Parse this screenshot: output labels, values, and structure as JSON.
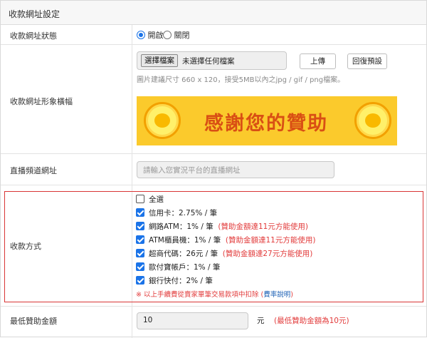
{
  "page": {
    "title": "收款網址設定"
  },
  "status": {
    "label": "收款網址狀態",
    "options": [
      {
        "label": "開啟",
        "selected": true
      },
      {
        "label": "關閉",
        "selected": false
      }
    ]
  },
  "image": {
    "label": "收款網址形象橫幅",
    "file_button": "選擇檔案",
    "file_status": "未選擇任何檔案",
    "upload_button": "上傳",
    "reset_button": "回復預設",
    "hint": "圖片建議尺寸 660 x 120，接受5MB以內之jpg / gif / png檔案。",
    "banner_text": "感謝您的贊助"
  },
  "stream": {
    "label": "直播頻道網址",
    "placeholder": "請輸入您實況平台的直播網址"
  },
  "payment": {
    "label": "收款方式",
    "select_all": {
      "label": "全選",
      "checked": false
    },
    "methods": [
      {
        "name": "信用卡",
        "fee": "：2.75% / 筆",
        "checked": true,
        "note": ""
      },
      {
        "name": "網路ATM",
        "fee": "：1% / 筆",
        "checked": true,
        "note": "(贊助金額達11元方能使用)"
      },
      {
        "name": "ATM櫃員機",
        "fee": "：1% / 筆",
        "checked": true,
        "note": "(贊助金額達11元方能使用)"
      },
      {
        "name": "超商代碼",
        "fee": "：26元 / 筆",
        "checked": true,
        "note": "(贊助金額達27元方能使用)"
      },
      {
        "name": "歐付寶帳戶",
        "fee": "：1% / 筆",
        "checked": true,
        "note": ""
      },
      {
        "name": "銀行快付",
        "fee": "：2% / 筆",
        "checked": true,
        "note": ""
      }
    ],
    "footnote": "※ 以上手續費從賣家單筆交易款項中扣除 (",
    "footnote_link": "費率說明",
    "footnote_end": ")"
  },
  "minimum": {
    "label": "最低贊助金額",
    "value": "10",
    "unit": "元",
    "note": "(最低贊助金額為10元)"
  },
  "colors": {
    "accent": "#1a73e8",
    "warning": "#e23b3b",
    "banner": "#fbca2c"
  }
}
